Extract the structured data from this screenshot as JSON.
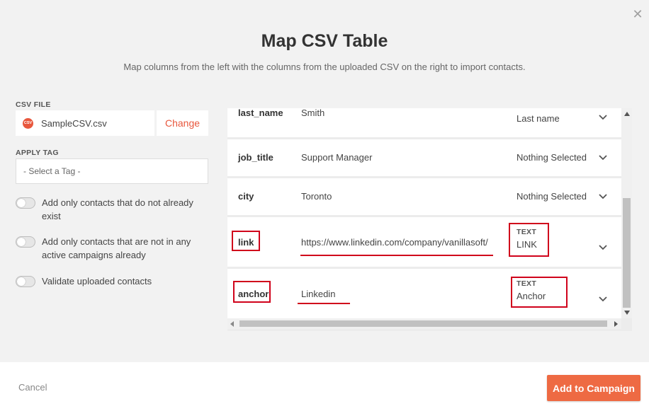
{
  "modal": {
    "title": "Map CSV Table",
    "subtitle": "Map columns from the left with the columns from the uploaded CSV on the right to import contacts."
  },
  "csv_file": {
    "label": "CSV FILE",
    "icon_text": "CSV",
    "file_name": "SampleCSV.csv",
    "change_label": "Change"
  },
  "apply_tag": {
    "label": "APPLY TAG",
    "placeholder": "- Select a Tag -"
  },
  "toggles": [
    {
      "label": "Add only contacts that do not already exist",
      "on": false
    },
    {
      "label": "Add only contacts that are not in any active campaigns already",
      "on": false
    },
    {
      "label": "Validate uploaded contacts",
      "on": false
    }
  ],
  "mapping_rows": [
    {
      "column": "last_name",
      "value": "Smith",
      "type": "",
      "mapped": "Last name"
    },
    {
      "column": "job_title",
      "value": "Support Manager",
      "type": "",
      "mapped": "Nothing Selected"
    },
    {
      "column": "city",
      "value": "Toronto",
      "type": "",
      "mapped": "Nothing Selected"
    },
    {
      "column": "link",
      "value": "https://www.linkedin.com/company/vanillasoft/",
      "type": "TEXT",
      "mapped": "LINK"
    },
    {
      "column": "anchor",
      "value": "Linkedin",
      "type": "TEXT",
      "mapped": "Anchor"
    }
  ],
  "footer": {
    "cancel_label": "Cancel",
    "submit_label": "Add to Campaign"
  },
  "colors": {
    "accent": "#ee6a43",
    "highlight": "#d0021b"
  }
}
